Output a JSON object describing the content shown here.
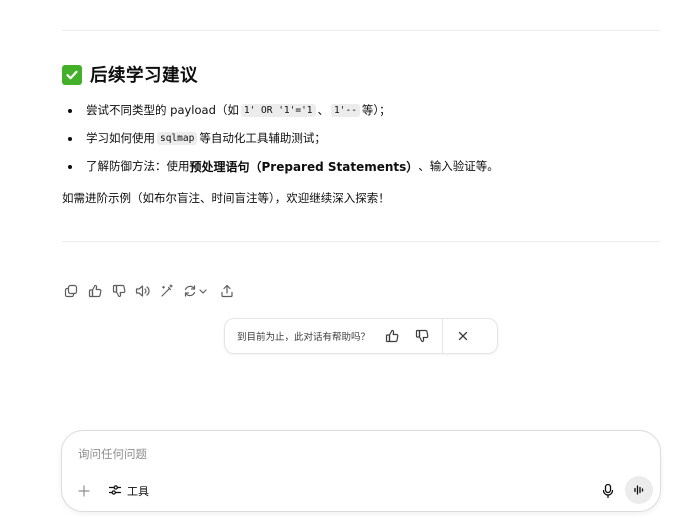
{
  "section": {
    "heading": "后续学习建议",
    "icon": "check-mark-icon",
    "icon_color": "#43b02a"
  },
  "tips": [
    {
      "prefix": "尝试不同类型的 payload（如 ",
      "code1": "1' OR '1'='1",
      "sep": "、",
      "code2": "1'--",
      "suffix": " 等）；"
    },
    {
      "prefix": "学习如何使用 ",
      "code": "sqlmap",
      "suffix": " 等自动化工具辅助测试；"
    },
    {
      "prefix": "了解防御方法：使用 ",
      "bold": "预处理语句（Prepared Statements）",
      "suffix": "、输入验证等。"
    }
  ],
  "closing": "如需进阶示例（如布尔盲注、时间盲注等），欢迎继续深入探索！",
  "actions": [
    "copy-icon",
    "thumbs-up-icon",
    "thumbs-down-icon",
    "read-aloud-icon",
    "edit-icon",
    "regenerate-icon",
    "share-icon"
  ],
  "feedback": {
    "question": "到目前为止，此对话有帮助吗？"
  },
  "composer": {
    "placeholder": "询问任何问题",
    "value": "",
    "tools_label": "工具"
  }
}
